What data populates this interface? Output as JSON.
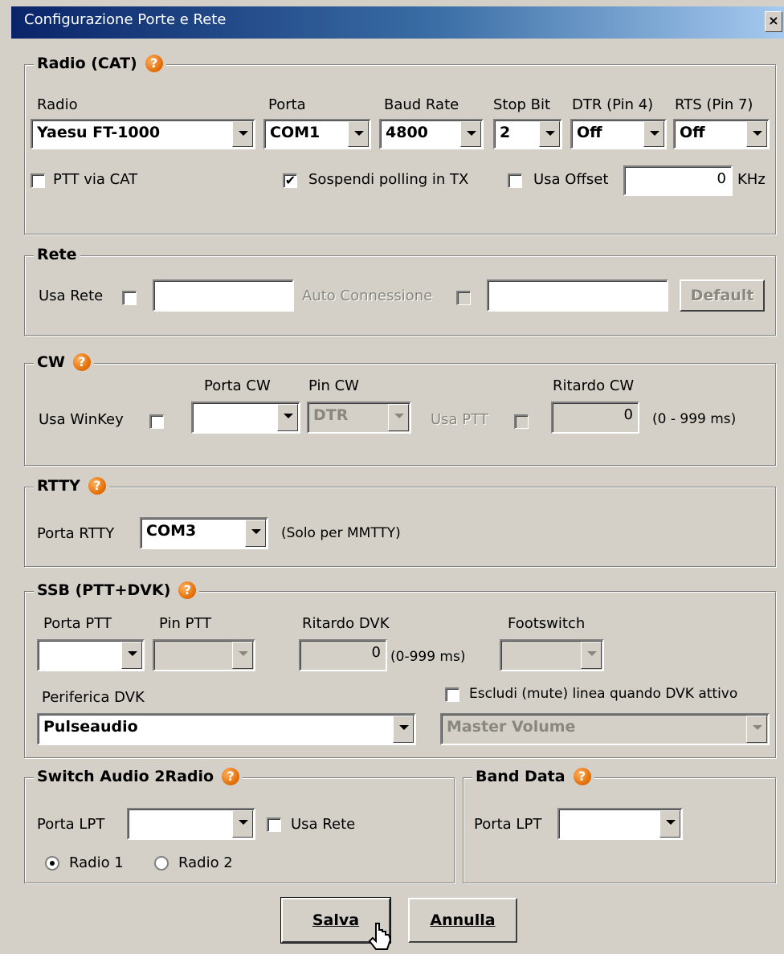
{
  "window": {
    "title": "Configurazione Porte e Rete",
    "close_label": "×"
  },
  "cat": {
    "legend": "Radio (CAT)",
    "labels": {
      "radio": "Radio",
      "porta": "Porta",
      "baud": "Baud Rate",
      "stop": "Stop Bit",
      "dtr": "DTR (Pin 4)",
      "rts": "RTS (Pin 7)"
    },
    "values": {
      "radio": "Yaesu FT-1000",
      "porta": "COM1",
      "baud": "4800",
      "stop": "2",
      "dtr": "Off",
      "rts": "Off"
    },
    "ptt_via_cat": {
      "label": "PTT via CAT",
      "checked": false
    },
    "sospendi": {
      "label": "Sospendi polling in TX",
      "checked": true
    },
    "usa_offset": {
      "label": "Usa Offset",
      "checked": false
    },
    "offset_value": "0",
    "offset_unit": "KHz"
  },
  "rete": {
    "legend": "Rete",
    "usa_rete_label": "Usa Rete",
    "auto_label": "Auto Connessione",
    "default_button": "Default"
  },
  "cw": {
    "legend": "CW",
    "porta_label": "Porta CW",
    "pin_label": "Pin CW",
    "ritardo_label": "Ritardo CW",
    "usa_winkey_label": "Usa WinKey",
    "pin_value": "DTR",
    "usa_ptt_label": "Usa PTT",
    "ritardo_value": "0",
    "range": "(0 - 999 ms)"
  },
  "rtty": {
    "legend": "RTTY",
    "porta_label": "Porta RTTY",
    "porta_value": "COM3",
    "note": "(Solo per MMTTY)"
  },
  "ssb": {
    "legend": "SSB (PTT+DVK)",
    "porta_ptt_label": "Porta PTT",
    "pin_ptt_label": "Pin PTT",
    "ritardo_label": "Ritardo DVK",
    "ritardo_value": "0",
    "ritardo_range": "(0-999 ms)",
    "footswitch_label": "Footswitch",
    "periferica_label": "Periferica DVK",
    "periferica_value": "Pulseaudio",
    "escludi_label": "Escludi (mute) linea quando DVK attivo",
    "master_value": "Master Volume"
  },
  "switch_audio": {
    "legend": "Switch Audio 2Radio",
    "porta_label": "Porta LPT",
    "usa_rete_label": "Usa Rete",
    "radio1_label": "Radio 1",
    "radio2_label": "Radio 2",
    "selected": "Radio 1"
  },
  "band_data": {
    "legend": "Band Data",
    "porta_label": "Porta LPT"
  },
  "buttons": {
    "salva": "Salva",
    "annulla": "Annulla"
  },
  "icons": {
    "help": "help-icon",
    "close": "close-icon",
    "cursor": "pointer-cursor-icon"
  }
}
